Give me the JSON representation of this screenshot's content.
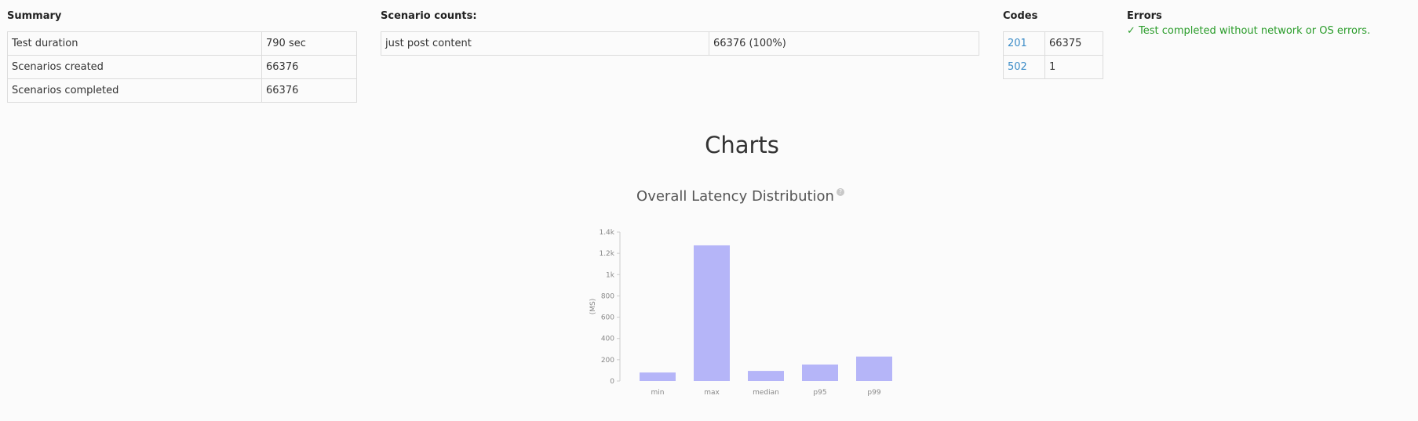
{
  "summary": {
    "heading": "Summary",
    "rows": [
      {
        "label": "Test duration",
        "value": "790 sec"
      },
      {
        "label": "Scenarios created",
        "value": "66376"
      },
      {
        "label": "Scenarios completed",
        "value": "66376"
      }
    ]
  },
  "scenario_counts": {
    "heading": "Scenario counts:",
    "rows": [
      {
        "label": "just post content",
        "value": "66376 (100%)"
      }
    ]
  },
  "codes": {
    "heading": "Codes",
    "rows": [
      {
        "code": "201",
        "count": "66375"
      },
      {
        "code": "502",
        "count": "1"
      }
    ]
  },
  "errors": {
    "heading": "Errors",
    "message": "✓ Test completed without network or OS errors."
  },
  "charts": {
    "heading": "Charts",
    "help_icon": "question-icon"
  },
  "colors": {
    "bar": "#b5b5f8",
    "link": "#3a8bc7",
    "success": "#2a9c2a"
  },
  "chart_data": {
    "type": "bar",
    "title": "Overall Latency Distribution",
    "xlabel": "",
    "ylabel": "(MS)",
    "categories": [
      "min",
      "max",
      "median",
      "p95",
      "p99"
    ],
    "values": [
      80,
      1275,
      95,
      155,
      230
    ],
    "ylim": [
      0,
      1400
    ],
    "yticks": [
      0,
      200,
      400,
      600,
      800,
      1000,
      1200,
      1400
    ],
    "ytick_labels": [
      "0",
      "200",
      "400",
      "600",
      "800",
      "1k",
      "1.2k",
      "1.4k"
    ],
    "grid": false
  }
}
